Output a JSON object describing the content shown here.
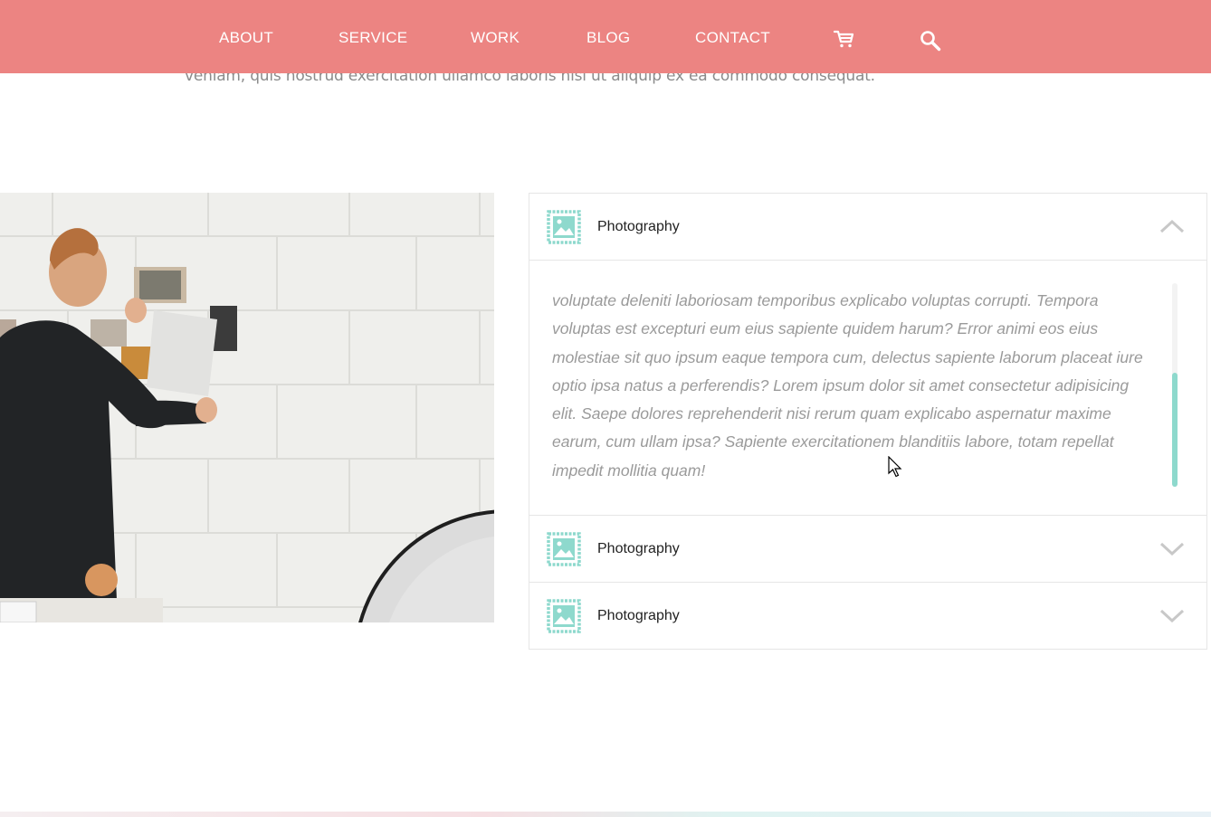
{
  "nav": {
    "items": [
      "ABOUT",
      "SERVICE",
      "WORK",
      "BLOG",
      "CONTACT"
    ],
    "icons": [
      "cart-icon",
      "search-icon"
    ]
  },
  "intro_text": "veniam, quis nostrud exercitation ullamco laboris nisi ut aliquip ex ea commodo consequat.",
  "accordion": {
    "items": [
      {
        "title": "Photography",
        "expanded": true,
        "body": "voluptate deleniti laboriosam temporibus explicabo voluptas corrupti. Tempora voluptas est excepturi eum eius sapiente quidem harum? Error animi eos eius molestiae sit quo ipsum eaque tempora cum, delectus sapiente laborum placeat iure optio ipsa natus a perferendis? Lorem ipsum dolor sit amet consectetur adipisicing elit. Saepe dolores reprehenderit nisi rerum quam explicabo aspernatur maxime earum, cum ullam ipsa? Sapiente exercitationem blanditiis labore, totam repellat impedit mollitia quam!"
      },
      {
        "title": "Photography",
        "expanded": false
      },
      {
        "title": "Photography",
        "expanded": false
      }
    ]
  },
  "colors": {
    "nav_bg": "#ec8482",
    "accent": "#8ed9cd",
    "text_muted": "#9a9a9a"
  }
}
